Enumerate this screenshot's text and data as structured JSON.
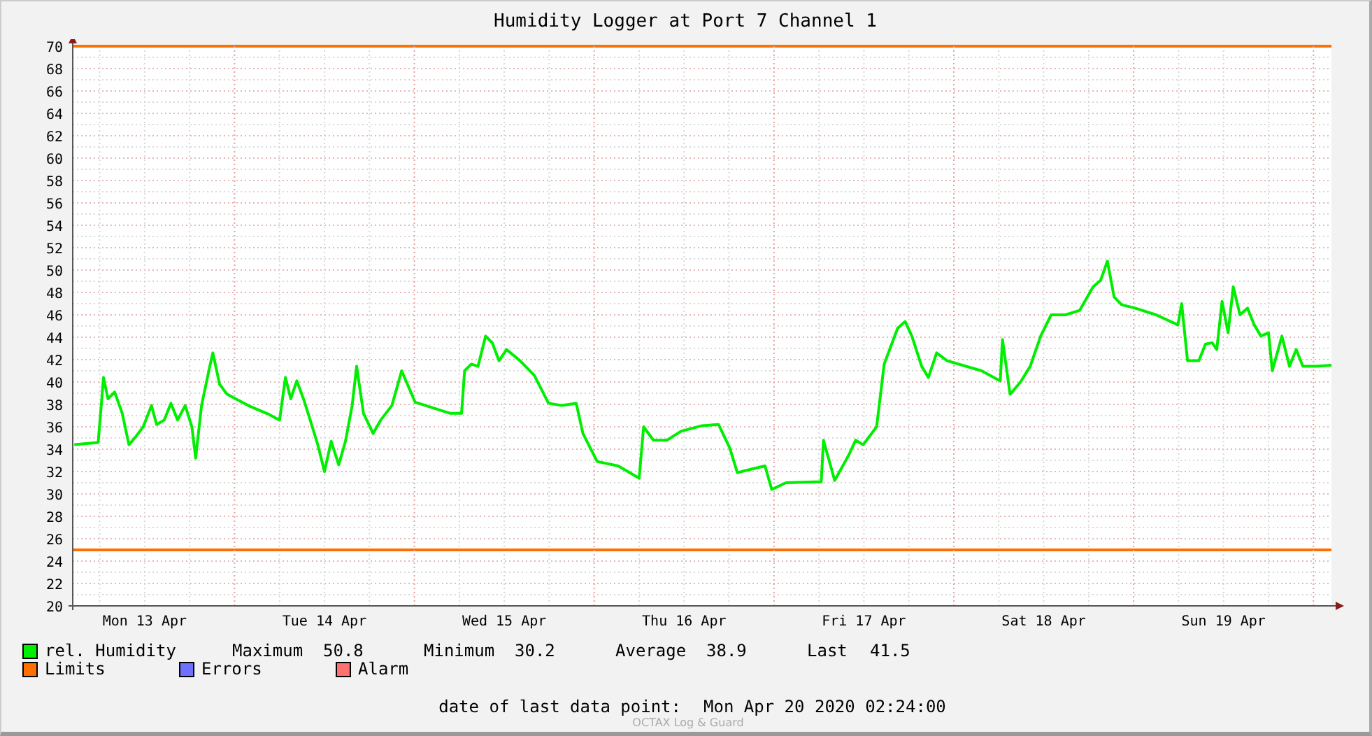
{
  "title": "Humidity Logger at Port 7 Channel 1",
  "chart_data": {
    "type": "line",
    "xlim": [
      "2020-04-13 02:24",
      "2020-04-20 02:24"
    ],
    "ylim": [
      20,
      70
    ],
    "yticks": [
      20,
      22,
      24,
      26,
      28,
      30,
      32,
      34,
      36,
      38,
      40,
      42,
      44,
      46,
      48,
      50,
      52,
      54,
      56,
      58,
      60,
      62,
      64,
      66,
      68,
      70
    ],
    "xticks": [
      {
        "value": "2020-04-13 12:00",
        "label": "Mon 13 Apr"
      },
      {
        "value": "2020-04-14 12:00",
        "label": "Tue 14 Apr"
      },
      {
        "value": "2020-04-15 12:00",
        "label": "Wed 15 Apr"
      },
      {
        "value": "2020-04-16 12:00",
        "label": "Thu 16 Apr"
      },
      {
        "value": "2020-04-17 12:00",
        "label": "Fri 17 Apr"
      },
      {
        "value": "2020-04-18 12:00",
        "label": "Sat 18 Apr"
      },
      {
        "value": "2020-04-19 12:00",
        "label": "Sun 19 Apr"
      }
    ],
    "x": [
      "2020-04-13 02:36",
      "2020-04-13 05:48",
      "2020-04-13 06:12",
      "2020-04-13 06:30",
      "2020-04-13 07:06",
      "2020-04-13 08:00",
      "2020-04-13 09:00",
      "2020-04-13 09:54",
      "2020-04-13 10:48",
      "2020-04-13 11:48",
      "2020-04-13 12:54",
      "2020-04-13 13:36",
      "2020-04-13 14:36",
      "2020-04-13 15:30",
      "2020-04-13 16:24",
      "2020-04-13 17:24",
      "2020-04-13 18:18",
      "2020-04-13 18:48",
      "2020-04-13 19:36",
      "2020-04-13 20:42",
      "2020-04-13 21:06",
      "2020-04-13 22:00",
      "2020-04-13 23:00",
      "2020-04-14 01:48",
      "2020-04-14 04:36",
      "2020-04-14 06:00",
      "2020-04-14 06:48",
      "2020-04-14 07:30",
      "2020-04-14 08:18",
      "2020-04-14 09:12",
      "2020-04-14 10:06",
      "2020-04-14 11:06",
      "2020-04-14 12:00",
      "2020-04-14 12:54",
      "2020-04-14 13:54",
      "2020-04-14 14:48",
      "2020-04-14 15:42",
      "2020-04-14 16:18",
      "2020-04-14 17:12",
      "2020-04-14 18:30",
      "2020-04-14 19:30",
      "2020-04-14 21:00",
      "2020-04-14 22:18",
      "2020-04-15 00:06",
      "2020-04-15 04:48",
      "2020-04-15 06:18",
      "2020-04-15 06:42",
      "2020-04-15 07:36",
      "2020-04-15 08:30",
      "2020-04-15 09:30",
      "2020-04-15 10:24",
      "2020-04-15 11:18",
      "2020-04-15 12:18",
      "2020-04-15 14:06",
      "2020-04-15 16:00",
      "2020-04-15 17:54",
      "2020-04-15 19:42",
      "2020-04-15 21:36",
      "2020-04-15 22:30",
      "2020-04-16 00:24",
      "2020-04-16 03:12",
      "2020-04-16 06:00",
      "2020-04-16 06:36",
      "2020-04-16 07:54",
      "2020-04-16 09:42",
      "2020-04-16 11:36",
      "2020-04-16 14:24",
      "2020-04-16 16:36",
      "2020-04-16 18:06",
      "2020-04-16 19:06",
      "2020-04-16 20:54",
      "2020-04-16 22:48",
      "2020-04-16 23:42",
      "2020-04-17 01:36",
      "2020-04-17 06:18",
      "2020-04-17 06:36",
      "2020-04-17 08:06",
      "2020-04-17 10:00",
      "2020-04-17 10:54",
      "2020-04-17 11:54",
      "2020-04-17 13:42",
      "2020-04-17 14:42",
      "2020-04-17 16:30",
      "2020-04-17 17:30",
      "2020-04-17 18:24",
      "2020-04-17 19:42",
      "2020-04-17 20:36",
      "2020-04-17 21:42",
      "2020-04-17 23:06",
      "2020-04-18 03:42",
      "2020-04-18 06:12",
      "2020-04-18 06:30",
      "2020-04-18 07:30",
      "2020-04-18 08:54",
      "2020-04-18 10:12",
      "2020-04-18 11:36",
      "2020-04-18 13:00",
      "2020-04-18 14:54",
      "2020-04-18 16:48",
      "2020-04-18 18:36",
      "2020-04-18 19:36",
      "2020-04-18 20:30",
      "2020-04-18 21:24",
      "2020-04-18 22:24",
      "2020-04-19 00:12",
      "2020-04-19 03:00",
      "2020-04-19 05:54",
      "2020-04-19 06:24",
      "2020-04-19 07:12",
      "2020-04-19 08:42",
      "2020-04-19 09:36",
      "2020-04-19 10:30",
      "2020-04-19 11:06",
      "2020-04-19 11:48",
      "2020-04-19 12:36",
      "2020-04-19 13:18",
      "2020-04-19 14:12",
      "2020-04-19 15:12",
      "2020-04-19 16:06",
      "2020-04-19 17:00",
      "2020-04-19 18:00",
      "2020-04-19 18:30",
      "2020-04-19 19:48",
      "2020-04-19 20:48",
      "2020-04-19 21:42",
      "2020-04-19 22:36",
      "2020-04-20 00:30",
      "2020-04-20 02:24"
    ],
    "series": [
      {
        "name": "rel. Humidity",
        "color": "#00ee00",
        "values": [
          34.4,
          34.6,
          37.9,
          40.4,
          38.5,
          39.1,
          37.2,
          34.4,
          35.1,
          36.0,
          37.9,
          36.2,
          36.6,
          38.1,
          36.6,
          37.9,
          36.0,
          33.2,
          37.9,
          41.4,
          42.6,
          39.8,
          38.9,
          37.9,
          37.1,
          36.6,
          40.4,
          38.5,
          40.1,
          38.5,
          36.6,
          34.4,
          32.0,
          34.7,
          32.6,
          34.7,
          37.9,
          41.4,
          37.2,
          35.4,
          36.6,
          37.9,
          41.0,
          38.2,
          37.2,
          37.2,
          41.0,
          41.6,
          41.4,
          44.1,
          43.5,
          41.9,
          42.9,
          41.9,
          40.6,
          38.1,
          37.9,
          38.1,
          35.4,
          32.9,
          32.5,
          31.4,
          36.0,
          34.8,
          34.8,
          35.6,
          36.1,
          36.2,
          34.1,
          31.9,
          32.2,
          32.5,
          30.4,
          31.0,
          31.1,
          34.8,
          31.2,
          33.5,
          34.8,
          34.4,
          36.0,
          41.6,
          44.8,
          45.4,
          44.1,
          41.4,
          40.4,
          42.6,
          41.9,
          41.0,
          40.1,
          43.8,
          38.9,
          40.0,
          41.4,
          44.1,
          46.0,
          46.0,
          46.4,
          48.5,
          49.1,
          50.8,
          47.6,
          46.9,
          46.6,
          46.0,
          45.1,
          47.0,
          41.9,
          41.9,
          43.4,
          43.5,
          42.9,
          47.2,
          44.4,
          48.5,
          46.0,
          46.6,
          45.1,
          44.1,
          44.4,
          41.0,
          44.1,
          41.4,
          42.9,
          41.4,
          41.4,
          41.5
        ]
      }
    ],
    "grid": true,
    "ref_lines": [
      {
        "axis": "y",
        "value": 70,
        "color": "#ff7000"
      },
      {
        "axis": "y",
        "value": 25,
        "color": "#ff7000"
      },
      {
        "axis": "x",
        "value": "2020-04-14 00:00",
        "color": "#e6a0a0"
      },
      {
        "axis": "x",
        "value": "2020-04-15 00:00",
        "color": "#e6a0a0"
      },
      {
        "axis": "x",
        "value": "2020-04-16 00:00",
        "color": "#e6a0a0"
      },
      {
        "axis": "x",
        "value": "2020-04-17 00:00",
        "color": "#e6a0a0"
      },
      {
        "axis": "x",
        "value": "2020-04-18 00:00",
        "color": "#e6a0a0"
      },
      {
        "axis": "x",
        "value": "2020-04-19 00:00",
        "color": "#e6a0a0"
      },
      {
        "axis": "x",
        "value": "2020-04-20 00:00",
        "color": "#e6a0a0"
      }
    ]
  },
  "legend": [
    {
      "label": "Limits",
      "color": "#ff7000"
    },
    {
      "label": "Errors",
      "color": "#7070ff"
    },
    {
      "label": "Alarm",
      "color": "#ff7070"
    }
  ],
  "stats": [
    {
      "label": "Maximum",
      "value": "50.8"
    },
    {
      "label": "Minimum",
      "value": "30.2"
    },
    {
      "label": "Average",
      "value": "38.9"
    },
    {
      "label": "Last",
      "value": "41.5"
    }
  ],
  "last_data_point": {
    "label": "date of last data point:",
    "value": "Mon Apr 20 2020 02:24:00"
  },
  "footer": "OCTAX Log & Guard"
}
